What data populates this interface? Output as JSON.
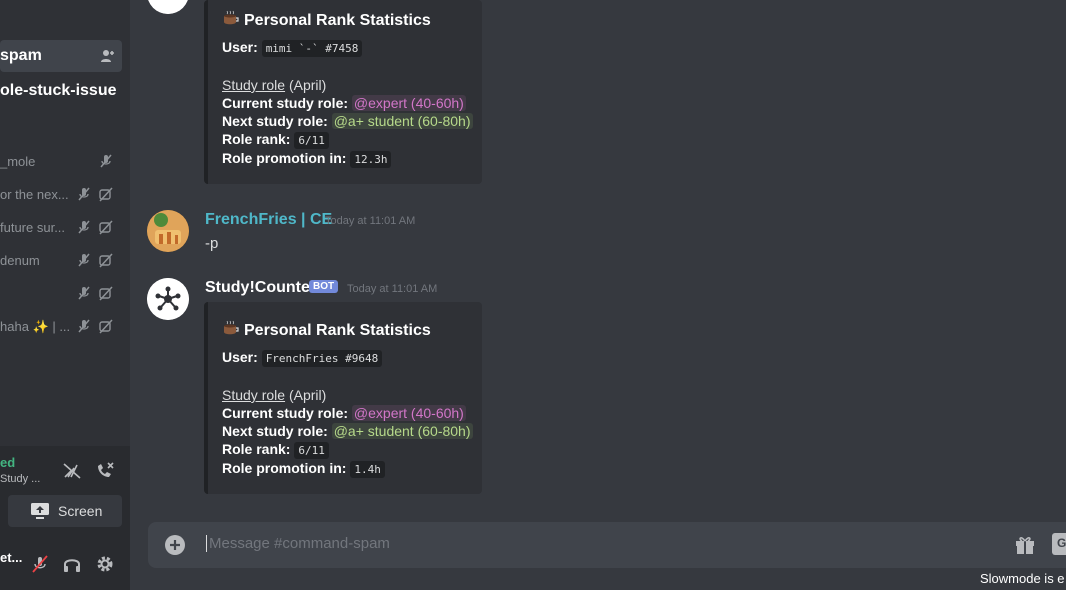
{
  "sidebar": {
    "active_channel": "spam",
    "channel2": "ole-stuck-issue",
    "voice_members": [
      {
        "name": "_mole"
      },
      {
        "name": "or the nex..."
      },
      {
        "name": "future sur..."
      },
      {
        "name": "denum"
      },
      {
        "name": ""
      },
      {
        "name": "haha ✨ | ..."
      }
    ],
    "voice_status": "ed",
    "voice_channel": "Study ...",
    "screen_label": "Screen",
    "user_name": "et..."
  },
  "messages": [
    {
      "embed": {
        "title": "Personal Rank Statistics",
        "user_label": "User:",
        "user_value": "mimi `-` #7458",
        "study_role_link": "Study role",
        "study_role_month": "(April)",
        "current_label": "Current study role:",
        "current_value": "@expert (40-60h)",
        "next_label": "Next study role:",
        "next_value": "@a+ student (60-80h)",
        "rank_label": "Role rank:",
        "rank_value": "6/11",
        "promo_label": "Role promotion in:",
        "promo_value": "12.3h"
      }
    },
    {
      "author": "FrenchFries | CE",
      "author_color": "#4fb8c9",
      "timestamp": "Today at 11:01 AM",
      "text": "-p"
    },
    {
      "author": "Study!Counter",
      "bot_tag": "BOT",
      "timestamp": "Today at 11:01 AM",
      "embed": {
        "title": "Personal Rank Statistics",
        "user_label": "User:",
        "user_value": "FrenchFries #9648",
        "study_role_link": "Study role",
        "study_role_month": "(April)",
        "current_label": "Current study role:",
        "current_value": "@expert (40-60h)",
        "next_label": "Next study role:",
        "next_value": "@a+ student (60-80h)",
        "rank_label": "Role rank:",
        "rank_value": "6/11",
        "promo_label": "Role promotion in:",
        "promo_value": "1.4h"
      }
    }
  ],
  "composer": {
    "placeholder": "Message #command-spam",
    "gif_label": "G"
  },
  "slowmode_text": "Slowmode is e",
  "icons": [
    "add-user-icon",
    "mic-muted-icon",
    "camera-off-icon",
    "signal-icon",
    "disconnect-icon",
    "screen-share-icon",
    "mute-icon",
    "headphones-icon",
    "settings-icon",
    "coffee-icon",
    "plus-icon",
    "gift-icon",
    "bot-hub-icon"
  ]
}
